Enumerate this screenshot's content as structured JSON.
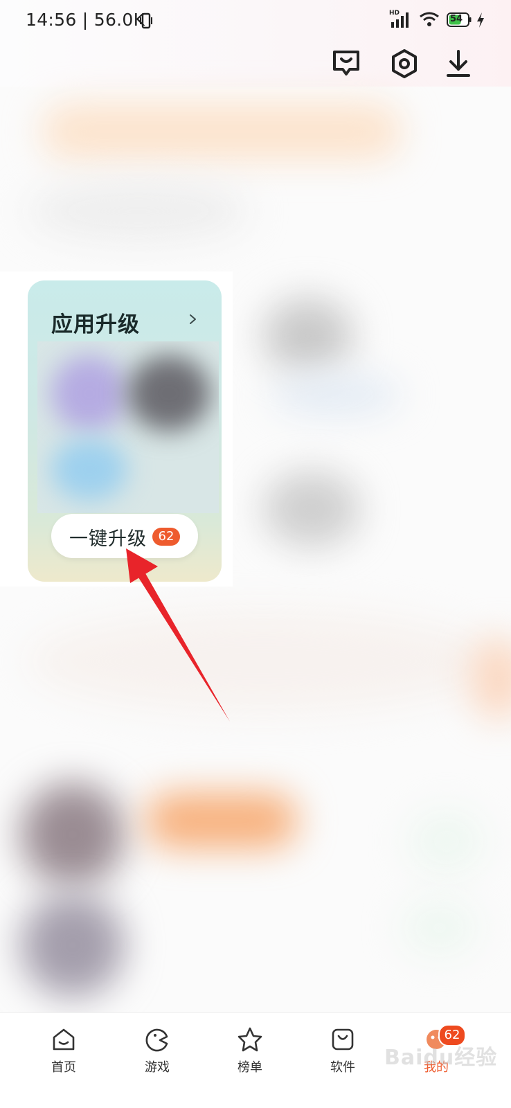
{
  "status_bar": {
    "time_speed": "14:56 | 56.0K",
    "network_label": "HD",
    "battery": "54"
  },
  "header": {
    "icons": [
      "message-icon",
      "settings-icon",
      "download-icon"
    ]
  },
  "card": {
    "title": "应用升级",
    "upgrade_button": "一键升级",
    "upgrade_count": "62"
  },
  "bottom_nav": {
    "items": [
      {
        "label": "首页",
        "icon": "home-icon"
      },
      {
        "label": "游戏",
        "icon": "game-icon"
      },
      {
        "label": "榜单",
        "icon": "star-icon"
      },
      {
        "label": "软件",
        "icon": "bag-icon"
      },
      {
        "label": "我的",
        "icon": "profile-icon",
        "badge": "62",
        "active": true
      }
    ]
  },
  "watermark": "Baidu经验",
  "colors": {
    "accent": "#ee5b2e",
    "card_top": "#c9ebea",
    "arrow": "#e8242a"
  }
}
